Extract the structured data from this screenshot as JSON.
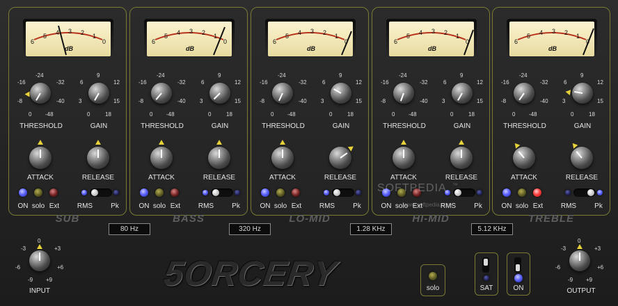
{
  "meter": {
    "scale": [
      "6",
      "5",
      "4",
      "3",
      "2",
      "1",
      "0"
    ],
    "unit": "dB"
  },
  "labels": {
    "threshold": "THRESHOLD",
    "gain": "GAIN",
    "attack": "ATTACK",
    "release": "RELEASE",
    "on": "ON",
    "solo": "solo",
    "ext": "Ext",
    "rms": "RMS",
    "pk": "Pk"
  },
  "threshold_scale": {
    "top": "-24",
    "tl": "-16",
    "tr": "-32",
    "ml": "-8",
    "mr": "-40",
    "bl": "0",
    "br": "-48"
  },
  "gain_scale": {
    "top": "9",
    "tl": "6",
    "tr": "12",
    "ml": "3",
    "mr": "15",
    "bl": "0",
    "br": "18"
  },
  "bands": [
    {
      "name": "SUB",
      "freq": "80 Hz"
    },
    {
      "name": "BASS",
      "freq": "320 Hz"
    },
    {
      "name": "LO-MID",
      "freq": "1.28 KHz"
    },
    {
      "name": "HI-MID",
      "freq": "5.12 KHz"
    },
    {
      "name": "TREBLE",
      "freq": ""
    }
  ],
  "input": {
    "label": "INPUT",
    "scale": {
      "top": "0",
      "tl": "-3",
      "tr": "+3",
      "ml": "-6",
      "mr": "+6",
      "bl": "-9",
      "br": "+9"
    }
  },
  "output": {
    "label": "OUTPUT",
    "scale": {
      "top": "0",
      "tl": "-3",
      "tr": "+3",
      "ml": "-6",
      "mr": "+6",
      "bl": "-9",
      "br": "+9"
    }
  },
  "logo": "5ORCERY",
  "master": {
    "solo": "solo",
    "sat": "SAT",
    "on": "ON"
  },
  "watermark": {
    "text": "SOFTPEDIA",
    "tm": "™",
    "url": "www.softpedia.com"
  },
  "colors": {
    "panel_border": "#7a7a34",
    "led_blue": "#5c63ff",
    "indicator_yellow": "#e8d23a"
  }
}
